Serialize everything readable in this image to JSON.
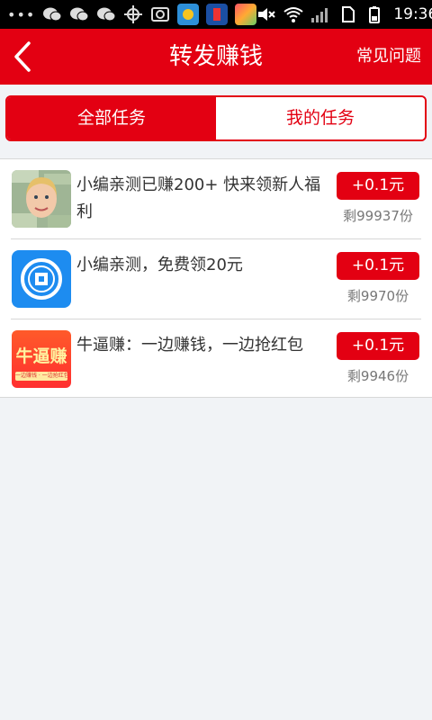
{
  "status_bar": {
    "dots": "•••",
    "time": "19:36",
    "left_icons": [
      "wechat-icon",
      "wechat-icon",
      "wechat-icon",
      "gps-icon",
      "screenshot-icon"
    ],
    "app_icons": [
      "weather-app-icon",
      "blue-app-icon",
      "photo-app-icon"
    ],
    "right_icons": [
      "mute-icon",
      "wifi-icon",
      "signal-icon",
      "sim-icon",
      "battery-icon"
    ]
  },
  "header": {
    "title": "转发赚钱",
    "faq_label": "常见问题",
    "accent": "#e30012"
  },
  "tabs": [
    {
      "label": "全部任务",
      "active": true
    },
    {
      "label": "我的任务",
      "active": false
    }
  ],
  "tasks": [
    {
      "title": "小编亲测已赚200+ 快来领新人福利",
      "reward": "+0.1元",
      "remaining": "剩99937份",
      "thumb": "money-face-thumbnail"
    },
    {
      "title": "小编亲测，免费领20元",
      "reward": "+0.1元",
      "remaining": "剩9970份",
      "thumb": "blue-coin-app-icon"
    },
    {
      "title": "牛逼赚：一边赚钱，一边抢红包",
      "reward": "+0.1元",
      "remaining": "剩9946份",
      "thumb": "niubizhuan-app-icon"
    }
  ],
  "thumb_text": {
    "niubizhuan_logo": "牛逼赚",
    "niubizhuan_strip": "一边赚钱 · 一边抢红包"
  }
}
